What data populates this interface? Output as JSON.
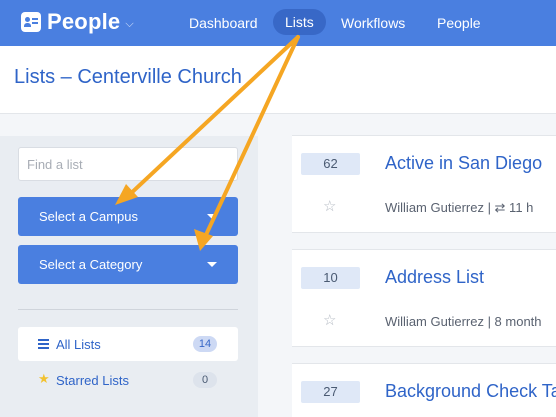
{
  "nav": {
    "brand": "People",
    "links": [
      {
        "label": "Dashboard"
      },
      {
        "label": "Lists"
      },
      {
        "label": "Workflows"
      },
      {
        "label": "People"
      }
    ]
  },
  "header": {
    "title": "Lists – Centerville Church"
  },
  "sidebar": {
    "search_placeholder": "Find a list",
    "campus_label": "Select a Campus",
    "category_label": "Select a Category",
    "items": [
      {
        "label": "All Lists",
        "count": "14"
      },
      {
        "label": "Starred Lists",
        "count": "0"
      }
    ]
  },
  "lists": [
    {
      "count": "62",
      "title": "Active in San Diego",
      "meta": "William Gutierrez | ⇄ 11 h"
    },
    {
      "count": "10",
      "title": "Address List",
      "meta": "William Gutierrez | 8 month"
    },
    {
      "count": "27",
      "title": "Background Check Ta"
    }
  ],
  "colors": {
    "accent": "#4a7fe0",
    "link": "#2f64c8",
    "annotation": "#f5a623"
  }
}
